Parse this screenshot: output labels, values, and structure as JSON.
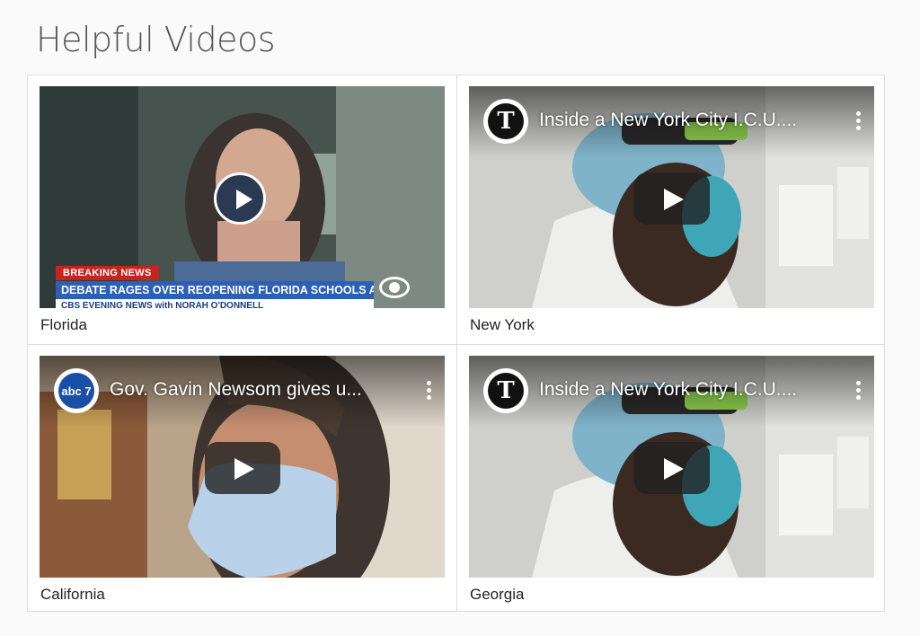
{
  "page": {
    "title": "Helpful Videos"
  },
  "videos": [
    {
      "caption": "Florida",
      "player": "news",
      "ticker": {
        "breaking": "BREAKING NEWS",
        "headline": "DEBATE RAGES OVER REOPENING FLORIDA SCHOOLS AMID SURGE IN CASES",
        "show": "CBS EVENING NEWS with NORAH O'DONNELL"
      },
      "play_icon": "round-play-icon"
    },
    {
      "caption": "New York",
      "player": "youtube",
      "title": "Inside a New York City I.C.U....",
      "channel_logo": "T",
      "play_icon": "youtube-play-icon"
    },
    {
      "caption": "California",
      "player": "youtube",
      "title": "Gov. Gavin Newsom gives u...",
      "channel_logo": "abc 7",
      "play_icon": "youtube-play-icon"
    },
    {
      "caption": "Georgia",
      "player": "youtube",
      "title": "Inside a New York City I.C.U....",
      "channel_logo": "T",
      "play_icon": "youtube-play-icon"
    }
  ],
  "colors": {
    "heading": "#555555",
    "border": "#dcdcdc",
    "breaking_red": "#c8241f",
    "ticker_blue": "#2c5fb8"
  }
}
